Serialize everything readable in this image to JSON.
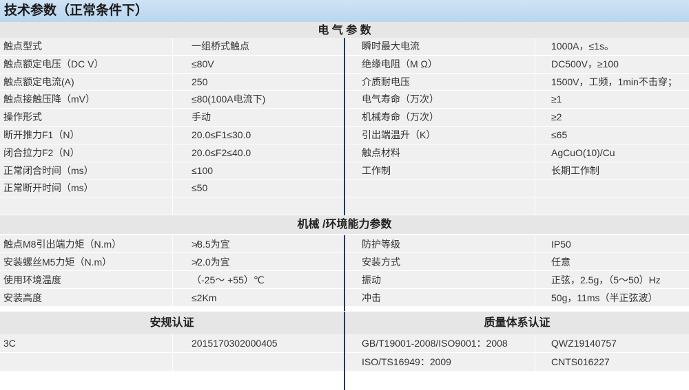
{
  "title": "技术参数（正常条件下）",
  "electrical": {
    "heading": "电 气 参 数",
    "rows": [
      [
        "触点型式",
        "一组桥式触点",
        "瞬时最大电流",
        "1000A，≤1s。"
      ],
      [
        "触点额定电压（DC V）",
        "≤80V",
        "绝缘电阻（M Ω）",
        "DC500V，≥100"
      ],
      [
        "触点额定电流(A)",
        "250",
        "介质耐电压",
        "1500V，工频，1min不击穿；"
      ],
      [
        "触点接触压降（mV）",
        "≤80(100A电流下)",
        "电气寿命（万次）",
        "≥1"
      ],
      [
        "操作形式",
        "手动",
        "机械寿命（万次）",
        "≥2"
      ],
      [
        "断开推力F1（N）",
        "20.0≤F1≤30.0",
        "引出端温升（K）",
        "≤65"
      ],
      [
        "闭合拉力F2（N）",
        "20.0≤F2≤40.0",
        "触点材料",
        "AgCuO(10)/Cu"
      ],
      [
        "正常闭合时间（ms）",
        "≤100",
        "工作制",
        "长期工作制"
      ],
      [
        "正常断开时间（ms）",
        "≤50",
        "",
        ""
      ],
      [
        "",
        "",
        "",
        ""
      ]
    ]
  },
  "mechanical": {
    "heading": "机械 /环境能力参数",
    "rows": [
      [
        "触点M8引出端力矩（N.m）",
        "≯8.5为宜",
        "防护等级",
        "IP50"
      ],
      [
        "安装螺丝M5力矩（N.m）",
        "≯2.0为宜",
        "安装方式",
        "任意"
      ],
      [
        "使用环境温度",
        "（-25～ +55）℃",
        "振动",
        "正弦，2.5g，（5～50）Hz"
      ],
      [
        "安装高度",
        "≤2Km",
        "冲击",
        "50g，11ms（半正弦波）"
      ]
    ]
  },
  "certification": {
    "safety_heading": "安规认证",
    "quality_heading": "质量体系认证",
    "rows": [
      [
        "3C",
        "2015170302000405",
        "GB/T19001-2008/ISO9001：2008",
        "QWZ19140757"
      ],
      [
        "",
        "",
        "ISO/TS16949：2009",
        "CNTS016227"
      ]
    ]
  }
}
